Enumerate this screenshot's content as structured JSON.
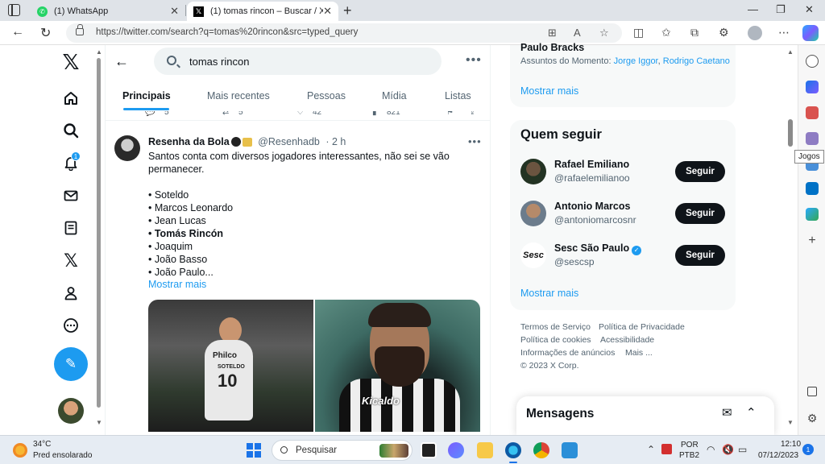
{
  "browser": {
    "tabs": [
      {
        "title": "(1) WhatsApp"
      },
      {
        "title": "(1) tomas rincon – Buscar / X"
      }
    ],
    "url": "https://twitter.com/search?q=tomas%20rincon&src=typed_query",
    "tooltip": "Jogos"
  },
  "left_nav": {
    "notification_count": "1",
    "items": [
      "home-icon",
      "search-icon",
      "bell-icon",
      "mail-icon",
      "lists-icon",
      "x-premium-icon",
      "profile-icon",
      "more-icon"
    ]
  },
  "search": {
    "query": "tomas rincon",
    "tabs": [
      "Principais",
      "Mais recentes",
      "Pessoas",
      "Mídia",
      "Listas"
    ],
    "active_tab": "Principais"
  },
  "previous_tweet_actions": {
    "replies": "5",
    "retweets": "5",
    "likes": "42",
    "views": "821"
  },
  "tweet": {
    "author": "Resenha da Bola",
    "handle": "@Resenhadb",
    "time": "· 2 h",
    "line1": "Santos conta com diversos jogadores interessantes, não sei se vão",
    "line2": "permanecer.",
    "players": [
      "• Soteldo",
      "• Marcos Leonardo",
      "• Jean Lucas",
      "• Tomás Rincón",
      "• Joaquim",
      "• João Basso",
      "• João Paulo..."
    ],
    "show_more": "Mostrar mais",
    "image1": {
      "sponsor": "Philco",
      "shirt_name": "SOTELDO",
      "number": "10"
    },
    "image2": {
      "sponsor": "Kicaldo"
    }
  },
  "right_column": {
    "trend": {
      "name": "Paulo Bracks",
      "prefix": "Assuntos do Momento:",
      "link1": "Jorge Iggor",
      "link2": "Rodrigo Caetano"
    },
    "show_more": "Mostrar mais",
    "who_to_follow": {
      "title": "Quem seguir",
      "accounts": [
        {
          "name": "Rafael Emiliano",
          "handle": "@rafaelemilianoo",
          "button": "Seguir"
        },
        {
          "name": "Antonio Marcos",
          "handle": "@antoniomarcosnr",
          "button": "Seguir"
        },
        {
          "name": "Sesc São Paulo",
          "handle": "@sescsp",
          "button": "Seguir",
          "avatar_text": "Sesc"
        }
      ],
      "show_more": "Mostrar mais"
    },
    "footer": {
      "terms": "Termos de Serviço",
      "privacy": "Política de Privacidade",
      "cookies": "Política de cookies",
      "accessibility": "Acessibilidade",
      "ads": "Informações de anúncios",
      "more": "Mais ...",
      "copyright": "© 2023 X Corp."
    },
    "messages": {
      "title": "Mensagens"
    }
  },
  "taskbar": {
    "weather_temp": "34°C",
    "weather_desc": "Pred ensolarado",
    "search_placeholder": "Pesquisar",
    "lang_top": "POR",
    "lang_bottom": "PTB2",
    "time": "12:10",
    "date": "07/12/2023",
    "notification_count": "1"
  },
  "colors": {
    "accent": "#1d9bf0",
    "follow_button": "#0f1419",
    "taskbar": "#e6ecf3"
  }
}
